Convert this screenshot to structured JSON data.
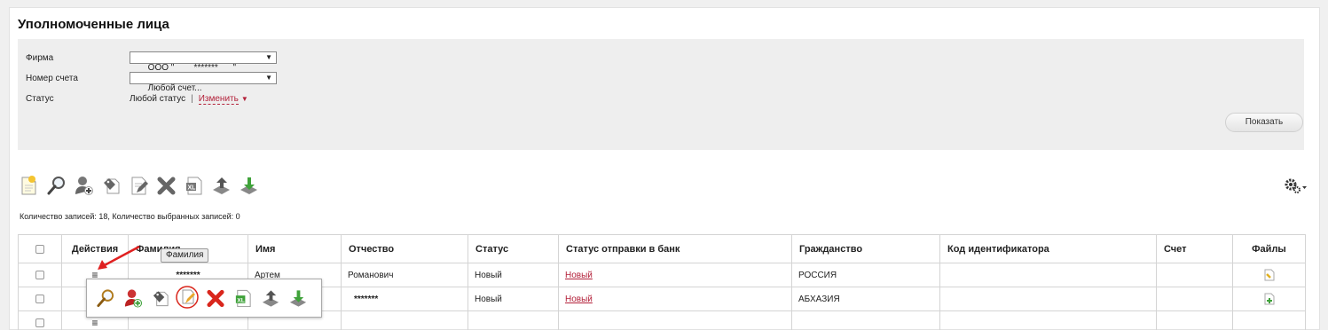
{
  "page": {
    "title": "Уполномоченные лица"
  },
  "filters": {
    "firm_label": "Фирма",
    "firm_value": "ООО \"        *******      \"",
    "account_label": "Номер счета",
    "account_value": "Любой счет...",
    "status_label": "Статус",
    "status_value": "Любой статус",
    "status_separator": "|",
    "status_change": "Изменить",
    "show_button": "Показать"
  },
  "toolbar": {
    "icons": [
      "new-document-icon",
      "search-icon",
      "add-person-icon",
      "tag-icon",
      "edit-icon",
      "delete-icon",
      "excel-export-icon",
      "upload-icon",
      "download-icon"
    ],
    "settings_icon": "gear-icon"
  },
  "counter": "Количество записей: 18, Количество выбранных записей: 0",
  "table": {
    "headers": [
      "",
      "Действия",
      "Фамилия",
      "Имя",
      "Отчество",
      "Статус",
      "Статус отправки в банк",
      "Гражданство",
      "Код идентификатора",
      "Счет",
      "Файлы"
    ],
    "rows": [
      {
        "surname": "*******",
        "name": "Артем",
        "patronymic": "Романович",
        "status": "Новый",
        "bank_status": "Новый",
        "citizenship": "РОССИЯ",
        "code": "",
        "account": ""
      },
      {
        "surname": "",
        "name": "",
        "patronymic": "*******",
        "status": "Новый",
        "bank_status": "Новый",
        "citizenship": "АБХАЗИЯ",
        "code": "",
        "account": ""
      },
      {
        "surname": "",
        "name": "",
        "patronymic": "",
        "status": "",
        "bank_status": "",
        "citizenship": "",
        "code": "",
        "account": ""
      }
    ]
  },
  "tooltip": "Фамилия",
  "popup_menu": {
    "icons": [
      "search-icon",
      "add-person-icon",
      "tag-icon",
      "edit-icon",
      "delete-icon",
      "excel-export-icon",
      "upload-icon",
      "download-icon"
    ],
    "highlighted": "edit-icon"
  },
  "colors": {
    "link": "#b3213a",
    "delete": "#d9261c",
    "download": "#3fa23a",
    "highlight_ring": "#d9261c"
  }
}
